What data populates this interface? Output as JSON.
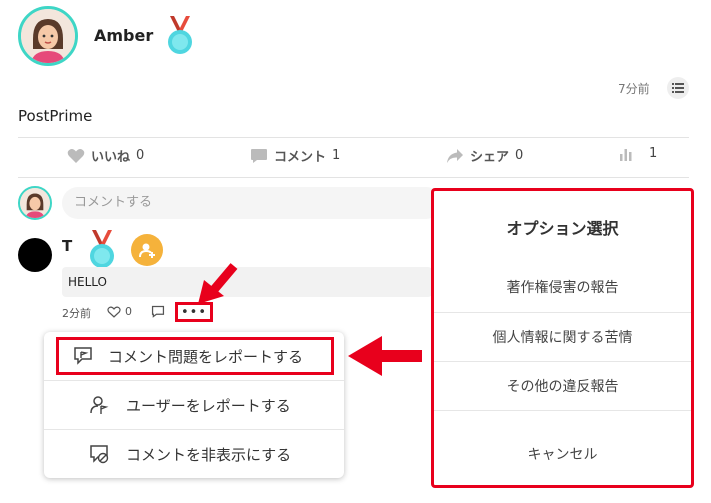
{
  "post": {
    "username": "Amber",
    "time": "7分前",
    "text": "PostPrime"
  },
  "actions": {
    "like_label": "いいね",
    "like_count": "0",
    "comment_label": "コメント",
    "comment_count": "1",
    "share_label": "シェア",
    "share_count": "0",
    "view_count": "1"
  },
  "comment_input": {
    "placeholder": "コメントする"
  },
  "comment": {
    "username": "T",
    "text": "HELLO",
    "time": "2分前",
    "like_count": "0",
    "more": "•••"
  },
  "menu": {
    "items": [
      {
        "label": "コメント問題をレポートする",
        "icon": "report-comment-icon"
      },
      {
        "label": "ユーザーをレポートする",
        "icon": "report-user-icon"
      },
      {
        "label": "コメントを非表示にする",
        "icon": "hide-comment-icon"
      }
    ]
  },
  "dialog": {
    "title": "オプション選択",
    "options": [
      "著作権侵害の報告",
      "個人情報に関する苦情",
      "その他の違反報告"
    ],
    "cancel": "キャンセル"
  },
  "colors": {
    "highlight_red": "#e8001c",
    "avatar_ring": "#3ed6c6",
    "follow_orange": "#f5b23b"
  }
}
